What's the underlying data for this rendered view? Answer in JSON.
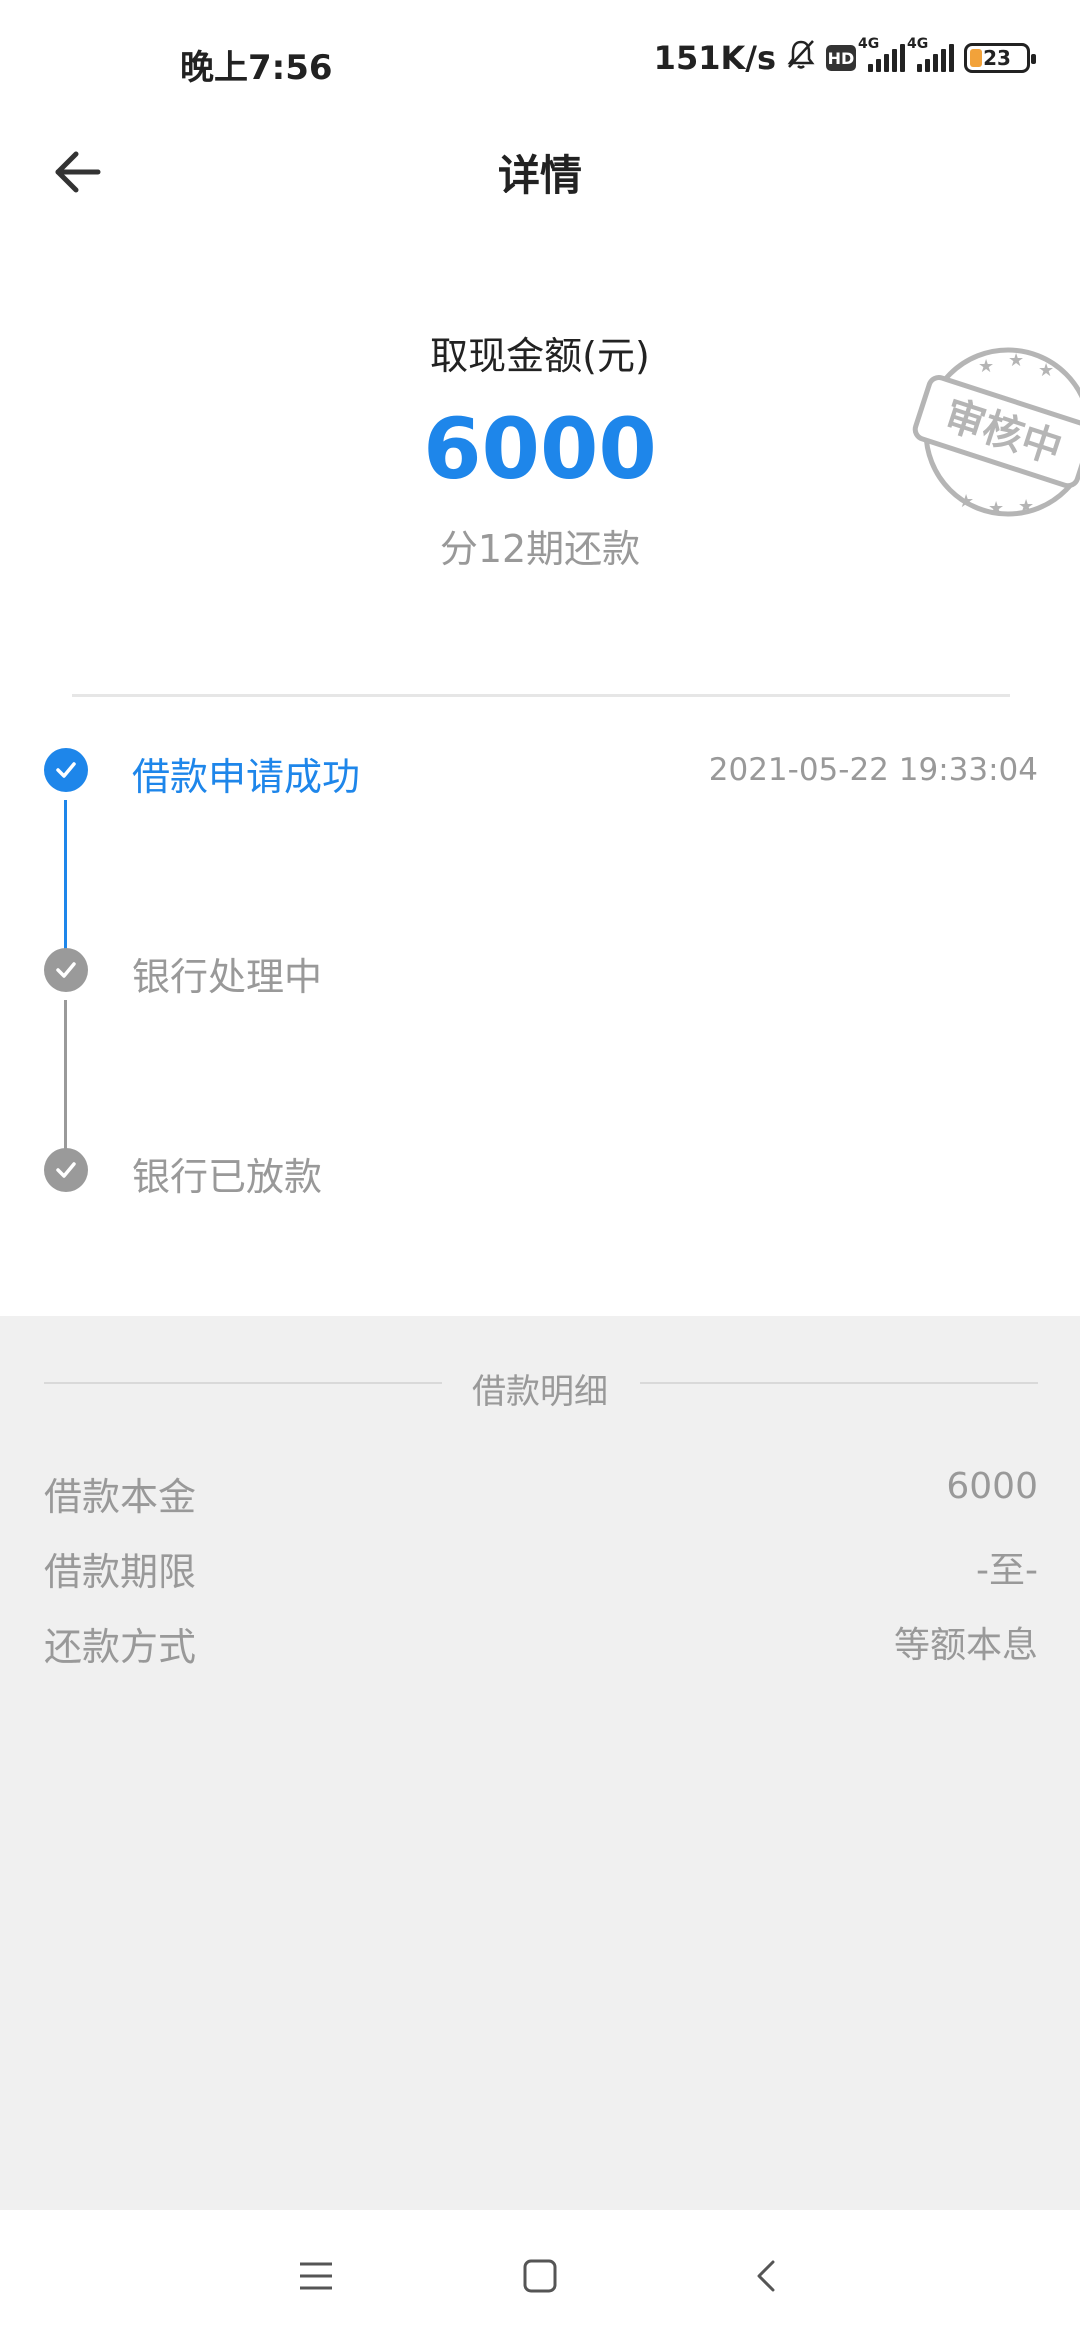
{
  "status_bar": {
    "time": "晚上7:56",
    "net_speed": "151K/s",
    "hd_label": "HD",
    "signal_1": "4G",
    "signal_2": "4G",
    "battery": "23"
  },
  "nav": {
    "title": "详情"
  },
  "amount": {
    "label": "取现金额(元)",
    "value": "6000",
    "terms": "分12期还款"
  },
  "stamp": {
    "text": "审核中"
  },
  "timeline": {
    "steps": [
      {
        "label": "借款申请成功",
        "time": "2021-05-22 19:33:04",
        "state": "done"
      },
      {
        "label": "银行处理中",
        "time": "",
        "state": "pending"
      },
      {
        "label": "银行已放款",
        "time": "",
        "state": "pending"
      }
    ]
  },
  "detail": {
    "title": "借款明细",
    "rows": [
      {
        "key": "借款本金",
        "value": "6000"
      },
      {
        "key": "借款期限",
        "value": "-至-"
      },
      {
        "key": "还款方式",
        "value": "等额本息"
      }
    ]
  },
  "colors": {
    "accent": "#1e86ea",
    "muted": "#999999",
    "pending_dot": "#9a9a9a",
    "detail_bg": "#f0f0f0"
  }
}
